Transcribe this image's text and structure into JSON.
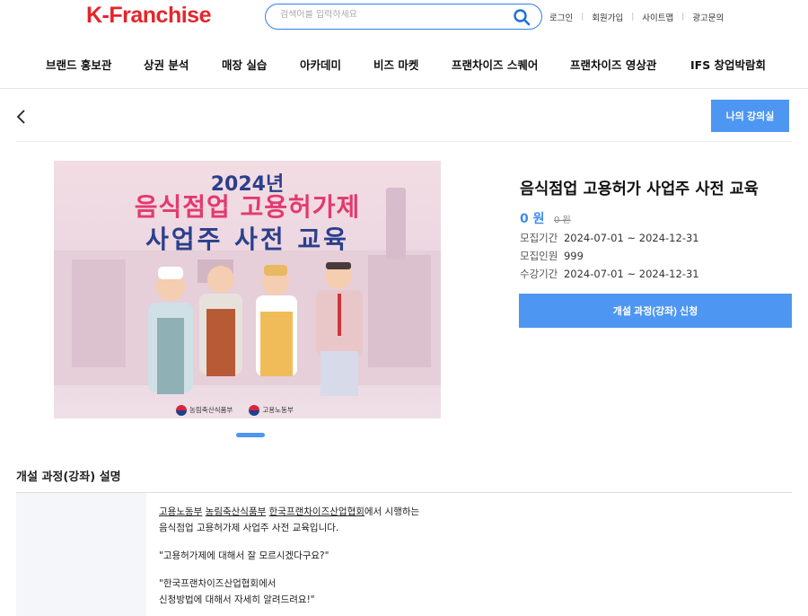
{
  "header": {
    "logo_text": "K-Franchise",
    "search_placeholder": "검색어를 입력하세요",
    "util_links": [
      "로그인",
      "회원가입",
      "사이트맵",
      "광고문의"
    ]
  },
  "nav": {
    "items": [
      "브랜드 홍보관",
      "상권 분석",
      "매장 실습",
      "아카데미",
      "비즈 마켓",
      "프랜차이즈 스퀘어",
      "프랜차이즈 영상관",
      "IFS 창업박람회"
    ]
  },
  "toolbar": {
    "my_course_label": "나의 강의실"
  },
  "banner": {
    "year": "2024년",
    "title_line1": "음식점업 고용허가제",
    "title_line2": "사업주 사전 교육",
    "logo1": "농림축산식품부",
    "logo2": "고용노동부"
  },
  "course": {
    "title": "음식점업 고용허가 사업주 사전 교육",
    "price": "0 원",
    "original_price": "0 원",
    "recruit_label": "모집기간",
    "recruit_period": "2024-07-01 ~ 2024-12-31",
    "capacity_label": "모집인원",
    "capacity": "999",
    "study_label": "수강기간",
    "study_period": "2024-07-01 ~ 2024-12-31",
    "apply_label": "개설 과정(강좌) 신청"
  },
  "description": {
    "heading": "개설 과정(강좌) 설명",
    "org1": "고용노동부",
    "org2": "농림축산식품부",
    "org3": "한국프랜차이즈산업협회",
    "line1_suffix": "에서 시행하는",
    "line2": "음식점업 고용허가제 사업주 사전 교육입니다.",
    "quote1": "\"고용허가제에 대해서 잘 모르시겠다구요?\"",
    "quote2_line1": "\"한국프랜차이즈산업협회에서",
    "quote2_line2": "신청방법에 대해서 자세히 알려드려요!\""
  },
  "colors": {
    "brand_red": "#e4252b",
    "accent_blue": "#4d96f2",
    "price_blue": "#3b8cf0"
  }
}
